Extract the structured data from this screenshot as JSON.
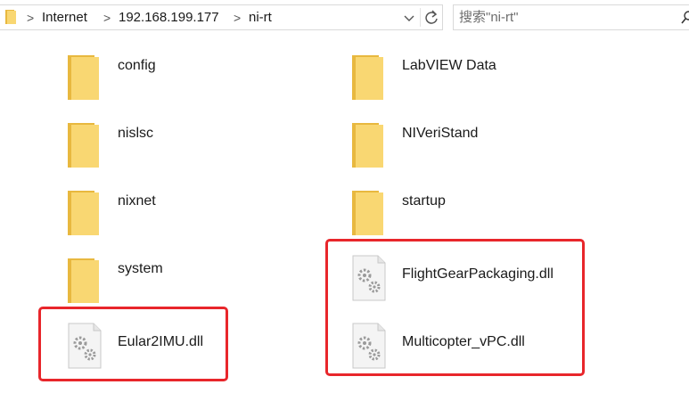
{
  "address_bar": {
    "breadcrumbs": [
      "Internet",
      "192.168.199.177",
      "ni-rt"
    ],
    "separator": ">"
  },
  "search": {
    "placeholder": "搜索\"ni-rt\""
  },
  "icons": {
    "address_folder": "folder-icon",
    "dropdown": "chevron-down-icon",
    "refresh": "refresh-icon",
    "search": "search-icon",
    "folder": "folder-icon",
    "dll": "dll-file-icon"
  },
  "colors": {
    "folder_main": "#f9d772",
    "folder_back": "#e8b83f",
    "highlight": "#e8262b"
  },
  "files": {
    "left": [
      {
        "name": "config",
        "type": "folder"
      },
      {
        "name": "nislsc",
        "type": "folder"
      },
      {
        "name": "nixnet",
        "type": "folder"
      },
      {
        "name": "system",
        "type": "folder"
      },
      {
        "name": "Eular2IMU.dll",
        "type": "dll"
      }
    ],
    "right": [
      {
        "name": "LabVIEW Data",
        "type": "folder"
      },
      {
        "name": "NIVeriStand",
        "type": "folder"
      },
      {
        "name": "startup",
        "type": "folder"
      },
      {
        "name": "FlightGearPackaging.dll",
        "type": "dll"
      },
      {
        "name": "Multicopter_vPC.dll",
        "type": "dll"
      }
    ]
  }
}
